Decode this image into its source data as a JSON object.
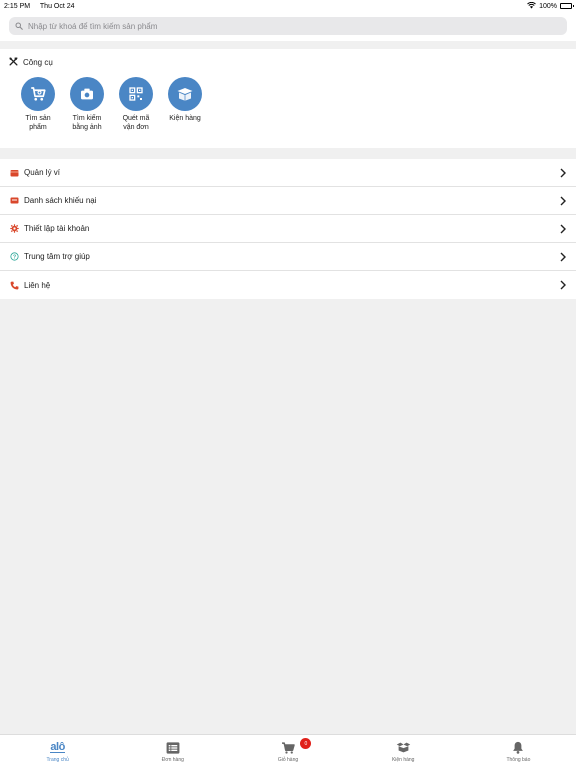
{
  "status_bar": {
    "time": "2:15 PM",
    "date": "Thu Oct 24",
    "battery": "100%"
  },
  "search": {
    "placeholder": "Nhập từ khoá để tìm kiếm sản phẩm"
  },
  "tools": {
    "title": "Công cụ",
    "items": [
      {
        "label": "Tìm sản phẩm",
        "icon": "cart-search-icon"
      },
      {
        "label": "Tìm kiếm bằng ảnh",
        "icon": "camera-icon"
      },
      {
        "label": "Quét mã vận đơn",
        "icon": "qr-code-icon"
      },
      {
        "label": "Kiện hàng",
        "icon": "package-box-icon"
      }
    ]
  },
  "menu": {
    "items": [
      {
        "label": "Quản lý ví",
        "icon": "wallet-icon"
      },
      {
        "label": "Danh sách khiếu nại",
        "icon": "complaint-icon"
      },
      {
        "label": "Thiết lập tài khoản",
        "icon": "gear-icon"
      },
      {
        "label": "Trung tâm trợ giúp",
        "icon": "help-icon"
      },
      {
        "label": "Liên hệ",
        "icon": "phone-icon"
      }
    ]
  },
  "tabbar": {
    "logo": "alô",
    "tabs": [
      {
        "label": "Trang chủ",
        "icon": "home-logo-icon"
      },
      {
        "label": "Đơn hàng",
        "icon": "orders-list-icon"
      },
      {
        "label": "Giỏ hàng",
        "icon": "cart-icon",
        "badge": "0"
      },
      {
        "label": "Kiện hàng",
        "icon": "package-icon"
      },
      {
        "label": "Thông báo",
        "icon": "bell-icon"
      }
    ]
  },
  "colors": {
    "accent": "#4a86c5",
    "menu_icon": "#d9472b",
    "help_icon": "#2fa89a",
    "badge": "#e0201a"
  }
}
